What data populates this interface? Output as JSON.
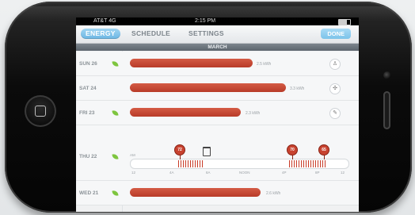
{
  "status_bar": {
    "carrier": "AT&T 4G",
    "time": "2:15 PM"
  },
  "nav": {
    "tabs": [
      {
        "label": "ENERGY",
        "active": true
      },
      {
        "label": "SCHEDULE",
        "active": false
      },
      {
        "label": "SETTINGS",
        "active": false
      }
    ],
    "done_label": "DONE"
  },
  "month": "MARCH",
  "days": [
    {
      "label": "SUN 26",
      "leaf": true,
      "usage_fraction": 0.56,
      "value_text": "2.5 kWh",
      "side_icon": "person-icon"
    },
    {
      "label": "SAT 24",
      "leaf": false,
      "usage_fraction": 0.77,
      "value_text": "3.3 kWh",
      "side_icon": "fan-icon"
    },
    {
      "label": "FRI 23",
      "leaf": true,
      "usage_fraction": 0.54,
      "value_text": "2.3 kWh",
      "side_icon": "thermostat-icon"
    },
    {
      "label": "THU 22",
      "leaf": true,
      "expanded": true
    },
    {
      "label": "WED 21",
      "leaf": true,
      "usage_fraction": 0.62,
      "value_text": "2.6 kWh"
    }
  ],
  "timeline": {
    "markers": [
      "72",
      "70",
      "65"
    ],
    "ticks": [
      "12",
      "4A",
      "8A",
      "NOON",
      "4P",
      "8P",
      "12"
    ],
    "ampm_label": "AM"
  },
  "colors": {
    "accent": "#6cb7e4",
    "bar": "#c84330",
    "leaf": "#7ec53f"
  }
}
